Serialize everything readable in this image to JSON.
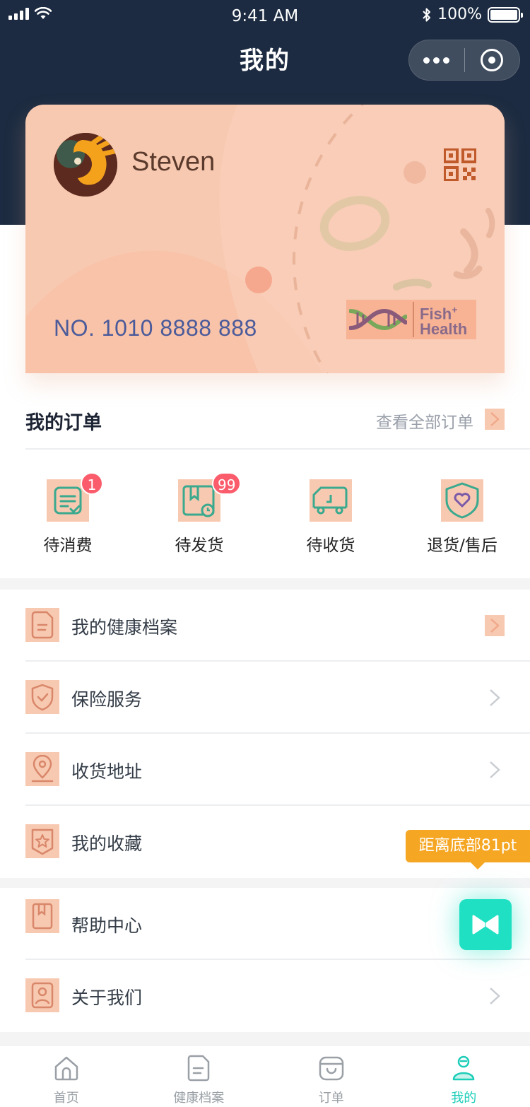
{
  "status_bar": {
    "time": "9:41 AM",
    "battery": "100%"
  },
  "nav": {
    "title": "我的"
  },
  "card": {
    "username": "Steven",
    "number": "NO. 1010 8888 888",
    "brand_line1": "Fish",
    "brand_plus": "+",
    "brand_line2": "Health"
  },
  "orders": {
    "title": "我的订单",
    "view_all": "查看全部订单",
    "statuses": [
      {
        "label": "待消费",
        "badge": "1",
        "icon": "receipt-check-icon"
      },
      {
        "label": "待发货",
        "badge": "99",
        "icon": "package-clock-icon"
      },
      {
        "label": "待收货",
        "badge": "",
        "icon": "truck-icon"
      },
      {
        "label": "退货/售后",
        "badge": "",
        "icon": "shield-heart-icon"
      }
    ]
  },
  "menu": [
    {
      "label": "我的健康档案",
      "icon": "health-record-icon"
    },
    {
      "label": "保险服务",
      "icon": "shield-check-icon"
    },
    {
      "label": "收货地址",
      "icon": "location-pin-icon"
    },
    {
      "label": "我的收藏",
      "icon": "star-badge-icon"
    },
    {
      "label": "帮助中心",
      "icon": "book-bookmark-icon"
    },
    {
      "label": "关于我们",
      "icon": "user-profile-icon"
    }
  ],
  "tip": {
    "text": "距离底部81pt"
  },
  "tabbar": [
    {
      "label": "首页",
      "icon": "home-icon"
    },
    {
      "label": "健康档案",
      "icon": "document-icon"
    },
    {
      "label": "订单",
      "icon": "bag-icon"
    },
    {
      "label": "我的",
      "icon": "person-icon",
      "active": true
    }
  ],
  "colors": {
    "header_bg": "#1c2b41",
    "card_bg": "#f8c9b1",
    "accent": "#1ccdb8",
    "badge": "#fb5c6b",
    "tip": "#f5a623"
  }
}
